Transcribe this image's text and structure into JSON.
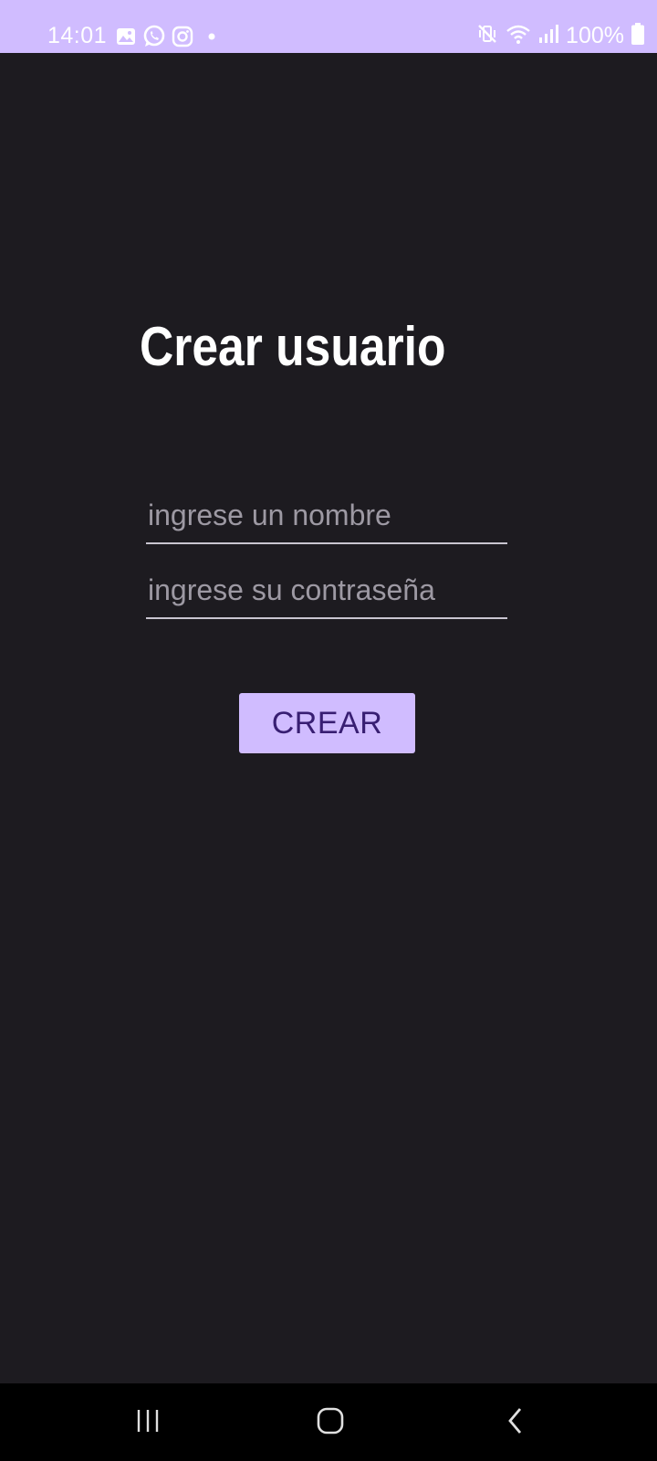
{
  "status_bar": {
    "time": "14:01",
    "battery_text": "100%",
    "background": "#d0bcff",
    "left_icons": [
      "gallery-icon",
      "whatsapp-icon",
      "instagram-icon",
      "notification-dot-icon"
    ],
    "right_icons": [
      "vibrate-mute-icon",
      "wifi-icon",
      "signal-icon",
      "battery-icon"
    ]
  },
  "main": {
    "title": "Crear usuario",
    "name_field": {
      "placeholder": "ingrese un nombre",
      "value": ""
    },
    "password_field": {
      "placeholder": "ingrese su contraseña",
      "value": ""
    },
    "create_button_label": "CREAR",
    "background": "#1d1b20",
    "button_color": "#d0bcff",
    "button_text_color": "#381e72"
  },
  "nav_bar": {
    "buttons": [
      "recent-apps-icon",
      "home-icon",
      "back-icon"
    ]
  }
}
